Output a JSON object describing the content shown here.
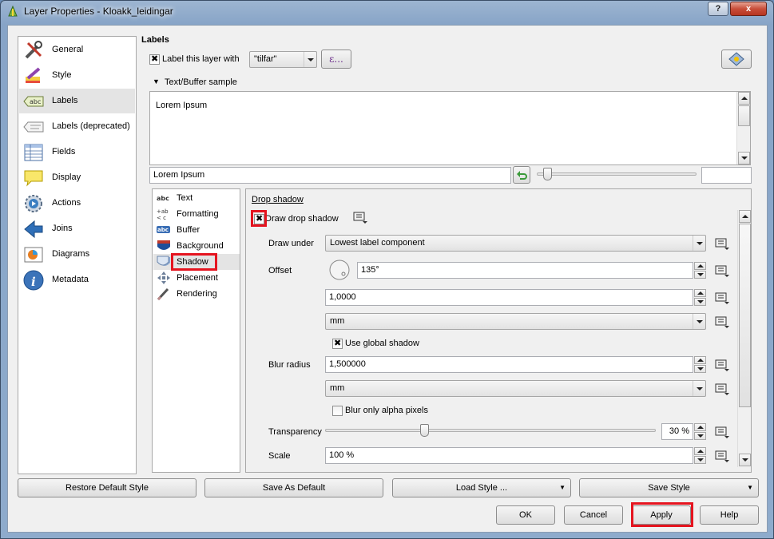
{
  "window": {
    "title": "Layer Properties - Kloakk_leidingar",
    "help_btn": "?",
    "close_btn": "x"
  },
  "sidebar": {
    "items": [
      {
        "label": "General",
        "icon": "tools-icon"
      },
      {
        "label": "Style",
        "icon": "brush-icon"
      },
      {
        "label": "Labels",
        "icon": "abc-label-icon"
      },
      {
        "label": "Labels (deprecated)",
        "icon": "label-deprecated-icon"
      },
      {
        "label": "Fields",
        "icon": "table-icon"
      },
      {
        "label": "Display",
        "icon": "speech-bubble-icon"
      },
      {
        "label": "Actions",
        "icon": "gear-play-icon"
      },
      {
        "label": "Joins",
        "icon": "join-arrow-icon"
      },
      {
        "label": "Diagrams",
        "icon": "diagram-icon"
      },
      {
        "label": "Metadata",
        "icon": "info-icon"
      }
    ],
    "selected": "Labels"
  },
  "labels": {
    "section_title": "Labels",
    "label_checkbox": "Label this layer with",
    "label_checked": true,
    "field_value": "\"tilfar\"",
    "expression_btn": "ε...",
    "sample_header": "Text/Buffer sample",
    "sample_text": "Lorem Ipsum",
    "sample_input": "Lorem Ipsum"
  },
  "subpanel": {
    "items": [
      {
        "label": "Text",
        "icon": "abc-text-icon"
      },
      {
        "label": "Formatting",
        "icon": "formatting-icon"
      },
      {
        "label": "Buffer",
        "icon": "buffer-icon"
      },
      {
        "label": "Background",
        "icon": "background-shield-icon"
      },
      {
        "label": "Shadow",
        "icon": "shadow-icon"
      },
      {
        "label": "Placement",
        "icon": "placement-icon"
      },
      {
        "label": "Rendering",
        "icon": "rendering-brush-icon"
      }
    ],
    "selected": "Shadow"
  },
  "shadow": {
    "group_title": "Drop shadow",
    "draw_checkbox": "Draw drop shadow",
    "draw_checked": true,
    "draw_under_label": "Draw under",
    "draw_under_value": "Lowest label component",
    "offset_label": "Offset",
    "offset_angle": "135°",
    "offset_distance": "1,0000",
    "offset_unit": "mm",
    "use_global_label": "Use global shadow",
    "use_global_checked": true,
    "blur_label": "Blur radius",
    "blur_value": "1,500000",
    "blur_unit": "mm",
    "blur_alpha_label": "Blur only alpha pixels",
    "blur_alpha_checked": false,
    "transparency_label": "Transparency",
    "transparency_value": "30 %",
    "transparency_fraction": 0.3,
    "scale_label": "Scale",
    "scale_value": "100 %"
  },
  "bottom": {
    "restore_style": "Restore Default Style",
    "save_default": "Save As Default",
    "load_style": "Load Style ...",
    "save_style": "Save Style",
    "ok": "OK",
    "cancel": "Cancel",
    "apply": "Apply",
    "help": "Help"
  },
  "colors": {
    "highlight_red": "#e5141f",
    "selection": "#e4e4e4"
  }
}
